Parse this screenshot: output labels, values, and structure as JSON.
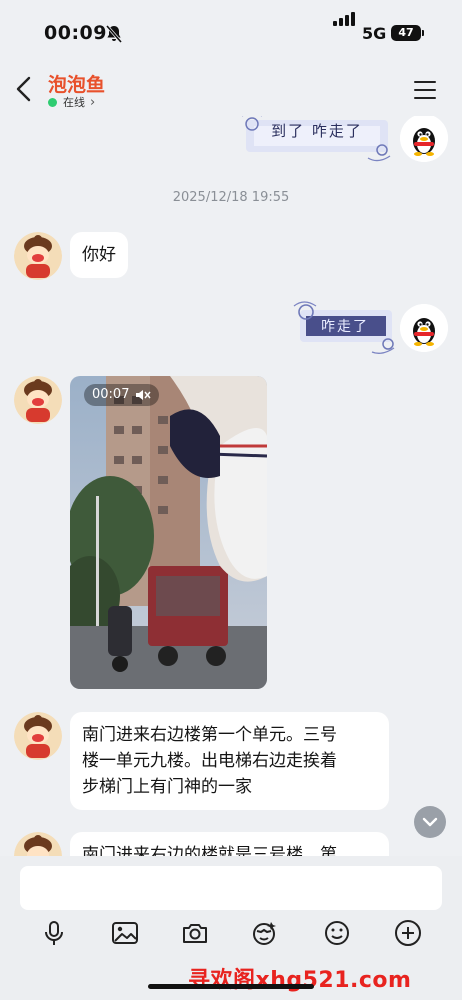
{
  "status_bar": {
    "time": "00:09",
    "network": "5G",
    "battery": "47"
  },
  "header": {
    "contact_name": "泡泡鱼",
    "presence": "在线"
  },
  "chat": {
    "sticker_1_text": "到了 咋走了",
    "timestamp": "2025/12/18 19:55",
    "msg_hello": "你好",
    "sticker_2_text": "咋走了",
    "video_duration": "00:07",
    "msg_directions_lines": [
      "南门进来右边楼第一个单元。三号",
      "楼一单元九楼。出电梯右边走挨着",
      "步梯门上有门神的一家"
    ],
    "msg_partial": "南门进来右边的楼就是三号楼，第"
  },
  "input": {
    "placeholder": ""
  },
  "watermark": "寻欢阁xhg521.com",
  "colors": {
    "accent": "#e8512c",
    "online": "#2ecc71",
    "bg": "#eef0f3",
    "watermark": "#e8231f"
  }
}
